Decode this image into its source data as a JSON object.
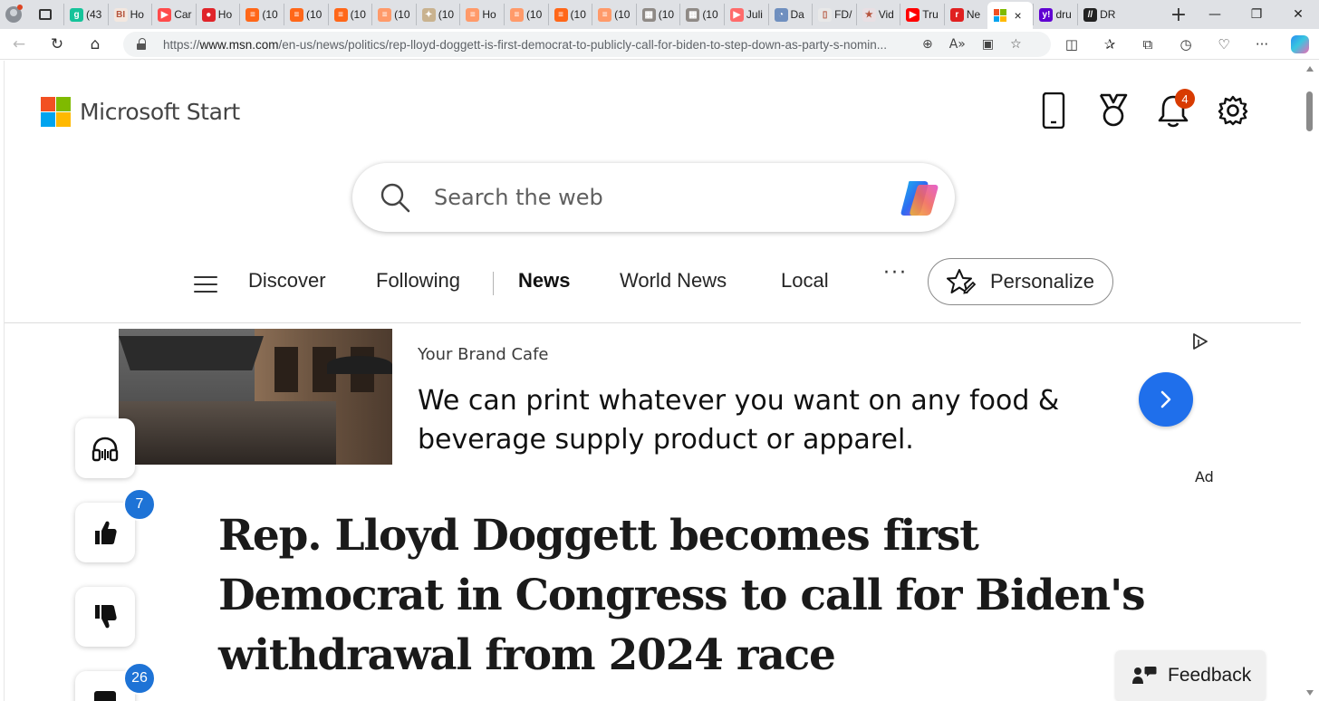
{
  "browser": {
    "tabs": [
      {
        "label": "(43",
        "icon": "grammarly-icon",
        "color": "#15c39a",
        "glyph": "g"
      },
      {
        "label": "Ho",
        "icon": "business-insider-icon",
        "color": "#f3e7df",
        "glyph": "BI"
      },
      {
        "label": "Car",
        "icon": "youtube-icon",
        "color": "#ff4b4b",
        "glyph": "▶"
      },
      {
        "label": "Ho",
        "icon": "podcast-icon",
        "color": "#e0242a",
        "glyph": "●"
      },
      {
        "label": "(10",
        "icon": "substack-icon",
        "color": "#ff6719",
        "glyph": "≡"
      },
      {
        "label": "(10",
        "icon": "substack-icon",
        "color": "#ff6719",
        "glyph": "≡"
      },
      {
        "label": "(10",
        "icon": "substack-icon",
        "color": "#ff6719",
        "glyph": "≡"
      },
      {
        "label": "(10",
        "icon": "substack-icon",
        "color": "#ff9a6a",
        "glyph": "≡"
      },
      {
        "label": "(10",
        "icon": "image-tab-icon",
        "color": "#c9b28f",
        "glyph": "✦"
      },
      {
        "label": "Ho",
        "icon": "substack-icon",
        "color": "#ff9a6a",
        "glyph": "≡"
      },
      {
        "label": "(10",
        "icon": "substack-icon",
        "color": "#ff9a6a",
        "glyph": "≡"
      },
      {
        "label": "(10",
        "icon": "substack-icon",
        "color": "#ff6719",
        "glyph": "≡"
      },
      {
        "label": "(10",
        "icon": "substack-icon",
        "color": "#ff9a6a",
        "glyph": "≡"
      },
      {
        "label": "(10",
        "icon": "photo-tab-icon",
        "color": "#8f8a86",
        "glyph": "▦"
      },
      {
        "label": "(10",
        "icon": "photo-tab-icon",
        "color": "#8f8a86",
        "glyph": "▦"
      },
      {
        "label": "Juli",
        "icon": "youtube-icon",
        "color": "#ff6b6b",
        "glyph": "▶"
      },
      {
        "label": "Da",
        "icon": "globe-tab-icon",
        "color": "#6f8fbf",
        "glyph": "◔"
      },
      {
        "label": "FD/",
        "icon": "document-icon",
        "color": "#e8e8e8",
        "glyph": "▯"
      },
      {
        "label": "Vid",
        "icon": "star-tab-icon",
        "color": "#e9dfe3",
        "glyph": "★"
      },
      {
        "label": "Tru",
        "icon": "youtube-icon",
        "color": "#ff0000",
        "glyph": "▶"
      },
      {
        "label": "Ne",
        "icon": "r-tab-icon",
        "color": "#e02020",
        "glyph": "r"
      },
      {
        "label": "",
        "icon": "microsoft-icon",
        "color": "#ffffff",
        "glyph": "",
        "active": true
      },
      {
        "label": "dru",
        "icon": "yahoo-icon",
        "color": "#6001d2",
        "glyph": "y!"
      },
      {
        "label": "DR",
        "icon": "dr-tab-icon",
        "color": "#222222",
        "glyph": "//"
      }
    ],
    "close_tab": "×",
    "new_tab": "+",
    "url_prefix": "https://",
    "url_domain": "www.msn.com",
    "url_path": "/en-us/news/politics/rep-lloyd-doggett-is-first-democrat-to-publicly-call-for-biden-to-step-down-as-party-s-nomin...",
    "extension_badge": "1"
  },
  "header": {
    "brand": "Microsoft Start",
    "notification_count": "4"
  },
  "search": {
    "placeholder": "Search the web"
  },
  "nav": {
    "items": [
      "Discover",
      "Following",
      "News",
      "World News",
      "Local"
    ],
    "active": "News",
    "more": "···",
    "personalize": "Personalize"
  },
  "ad": {
    "sponsor": "Your Brand Cafe",
    "title": "We can print whatever you want on any food & beverage supply product or apparel.",
    "label": "Ad"
  },
  "actions": {
    "like_count": "7",
    "comment_count": "26"
  },
  "article": {
    "headline": "Rep. Lloyd Doggett becomes first Democrat in Congress to call for Biden's withdrawal from 2024 race"
  },
  "feedback": {
    "label": "Feedback"
  },
  "colors": {
    "accent": "#1f6feb",
    "badge_blue": "#1e73d6",
    "notification": "#d83b01",
    "ms_red": "#f25022",
    "ms_green": "#7fba00",
    "ms_blue": "#00a4ef",
    "ms_yellow": "#ffb900"
  }
}
